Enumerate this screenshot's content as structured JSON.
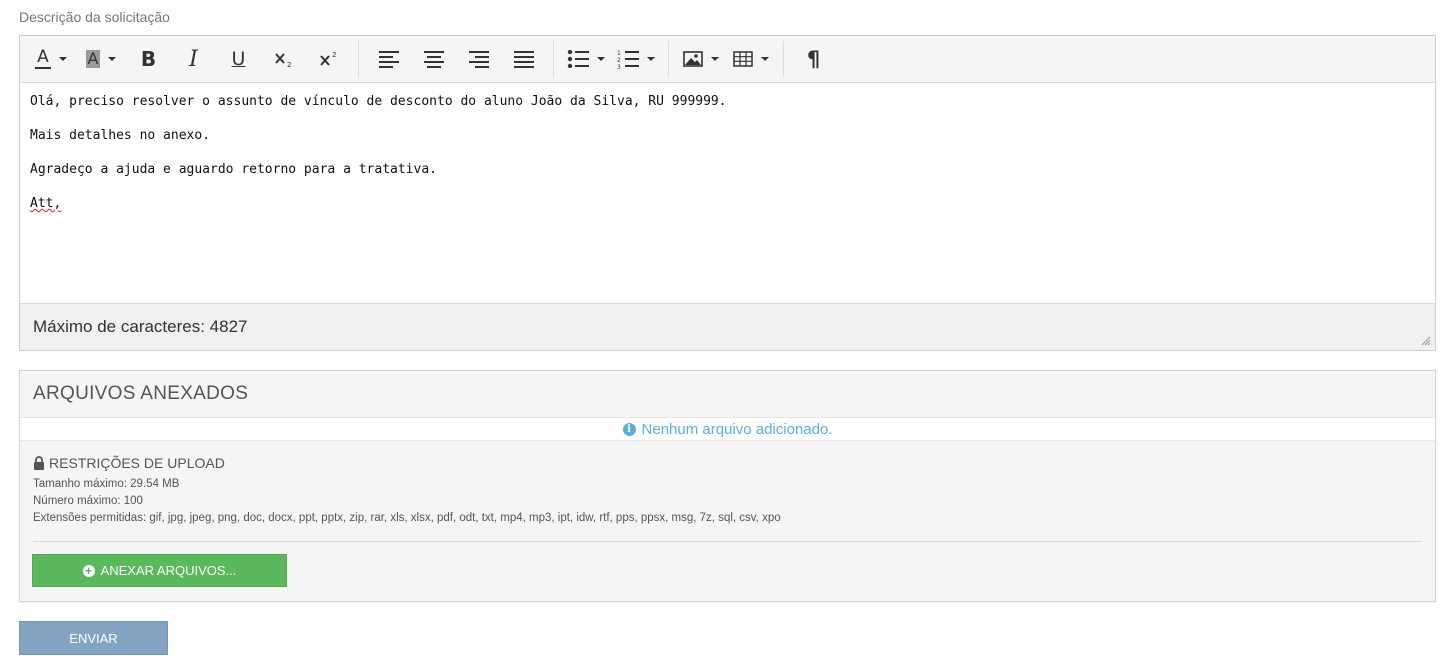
{
  "form": {
    "description_label": "Descrição da solicitação",
    "send_label": "ENVIAR"
  },
  "editor": {
    "toolbar": [
      {
        "icon": "font-color-icon",
        "has_dropdown": true
      },
      {
        "icon": "background-color-icon",
        "has_dropdown": true
      },
      {
        "icon": "bold-icon"
      },
      {
        "icon": "italic-icon"
      },
      {
        "icon": "underline-icon"
      },
      {
        "icon": "subscript-icon"
      },
      {
        "icon": "superscript-icon"
      },
      {
        "icon": "align-left-icon"
      },
      {
        "icon": "align-center-icon"
      },
      {
        "icon": "align-right-icon"
      },
      {
        "icon": "align-justify-icon"
      },
      {
        "icon": "bulleted-list-icon",
        "has_dropdown": true
      },
      {
        "icon": "numbered-list-icon",
        "has_dropdown": true
      },
      {
        "icon": "image-icon",
        "has_dropdown": true
      },
      {
        "icon": "table-icon",
        "has_dropdown": true
      },
      {
        "icon": "paragraph-icon"
      }
    ],
    "glyphs": {
      "font_color": "A",
      "background_color": "A",
      "bold": "B",
      "italic": "I",
      "underline": "U",
      "paragraph": "¶"
    },
    "content": [
      "Olá, preciso resolver o assunto de vínculo de desconto do aluno João da Silva, RU 999999.",
      "Mais detalhes no anexo.",
      "Agradeço a ajuda e aguardo retorno para a tratativa.",
      "Att,"
    ],
    "status_text": "Máximo de caracteres: 4827"
  },
  "attachments": {
    "title": "ARQUIVOS ANEXADOS",
    "empty_message": "Nenhum arquivo adicionado.",
    "restrictions": {
      "title": "RESTRIÇÕES DE UPLOAD",
      "max_size": "Tamanho máximo: 29.54 MB",
      "max_count": "Número máximo: 100",
      "extensions": "Extensões permitidas: gif, jpg, jpeg, png, doc, docx, ppt, pptx, zip, rar, xls, xlsx, pdf, odt, txt, mp4, mp3, ipt, idw, rtf, pps, ppsx, msg, 7z, sql, csv, xpo"
    },
    "attach_button": "ANEXAR ARQUIVOS..."
  },
  "colors": {
    "attach_button": "#5cb85c",
    "send_button": "#84a4c4",
    "info_text": "#5bb0d8"
  }
}
